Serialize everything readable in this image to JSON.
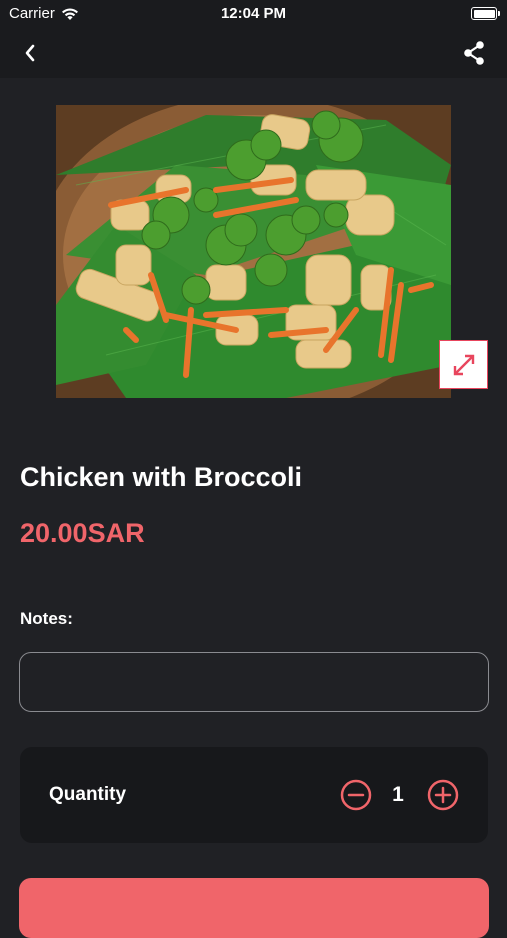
{
  "status_bar": {
    "carrier": "Carrier",
    "time": "12:04 PM"
  },
  "nav": {
    "back_icon": "chevron-left-icon",
    "share_icon": "share-icon"
  },
  "product": {
    "image_alt": "Chicken with Broccoli",
    "title": "Chicken with Broccoli",
    "price": "20.00SAR"
  },
  "notes": {
    "label": "Notes:",
    "value": "",
    "placeholder": ""
  },
  "quantity": {
    "label": "Quantity",
    "value": "1"
  },
  "colors": {
    "accent": "#f0656a",
    "background": "#202125",
    "card": "#17181b",
    "expand_border": "#e8455d"
  }
}
